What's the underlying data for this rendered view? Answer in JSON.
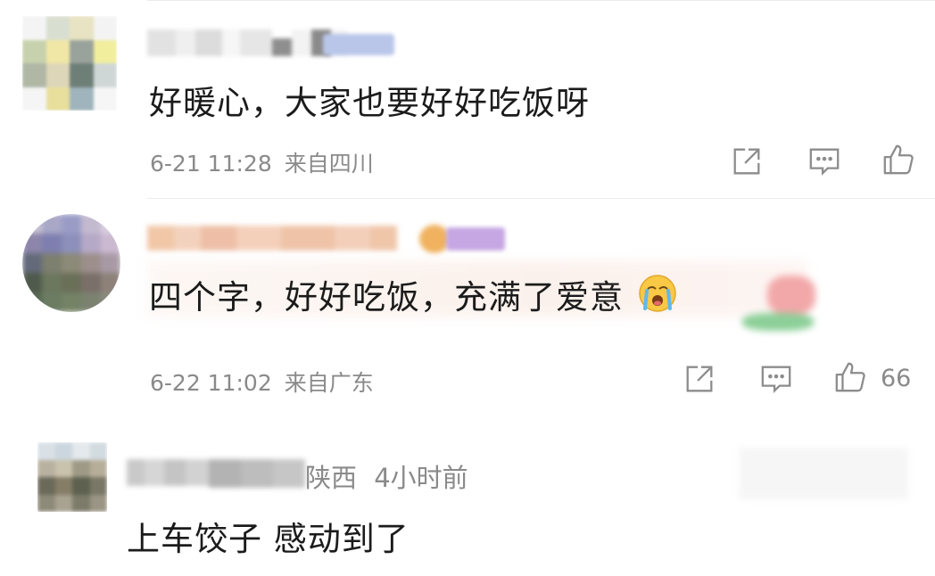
{
  "comments": [
    {
      "text": "好暖心，大家也要好好吃饭呀",
      "time": "6-21 11:28",
      "location": "来自四川",
      "likes": ""
    },
    {
      "text": "四个字，好好吃饭，充满了爱意",
      "emoji": "crying-face",
      "time": "6-22 11:02",
      "location": "来自广东",
      "likes": "66"
    },
    {
      "text": "上车饺子 感动到了",
      "region": "陕西",
      "age": "4小时前"
    }
  ],
  "colors": {
    "text": "#1b1b1b",
    "meta": "#8a8a8a",
    "divider": "#ececec",
    "icon": "#8c8c8c"
  },
  "icons": [
    "share-icon",
    "comment-icon",
    "like-icon"
  ]
}
